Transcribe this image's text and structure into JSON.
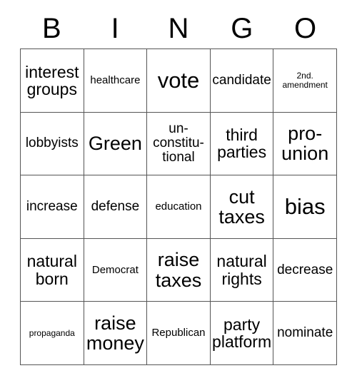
{
  "card": {
    "headers": [
      "B",
      "I",
      "N",
      "G",
      "O"
    ],
    "rows": [
      [
        {
          "text": "interest\ngroups",
          "size": "lg"
        },
        {
          "text": "healthcare",
          "size": "sm"
        },
        {
          "text": "vote",
          "size": "xxl"
        },
        {
          "text": "candidate",
          "size": "md"
        },
        {
          "text": "2nd.\namendment",
          "size": "xs"
        }
      ],
      [
        {
          "text": "lobbyists",
          "size": "md"
        },
        {
          "text": "Green",
          "size": "xl"
        },
        {
          "text": "un-\nconstitu-\ntional",
          "size": "md"
        },
        {
          "text": "third\nparties",
          "size": "lg"
        },
        {
          "text": "pro-\nunion",
          "size": "xl"
        }
      ],
      [
        {
          "text": "increase",
          "size": "md"
        },
        {
          "text": "defense",
          "size": "md"
        },
        {
          "text": "education",
          "size": "sm"
        },
        {
          "text": "cut\ntaxes",
          "size": "xl"
        },
        {
          "text": "bias",
          "size": "xxl"
        }
      ],
      [
        {
          "text": "natural\nborn",
          "size": "lg"
        },
        {
          "text": "Democrat",
          "size": "sm"
        },
        {
          "text": "raise\ntaxes",
          "size": "xl"
        },
        {
          "text": "natural\nrights",
          "size": "lg"
        },
        {
          "text": "decrease",
          "size": "md"
        }
      ],
      [
        {
          "text": "propaganda",
          "size": "xs"
        },
        {
          "text": "raise\nmoney",
          "size": "xl"
        },
        {
          "text": "Republican",
          "size": "sm"
        },
        {
          "text": "party\nplatform",
          "size": "lg"
        },
        {
          "text": "nominate",
          "size": "md"
        }
      ]
    ]
  },
  "colors": {
    "background": "#ffffff",
    "text": "#000000",
    "border": "#555555"
  }
}
